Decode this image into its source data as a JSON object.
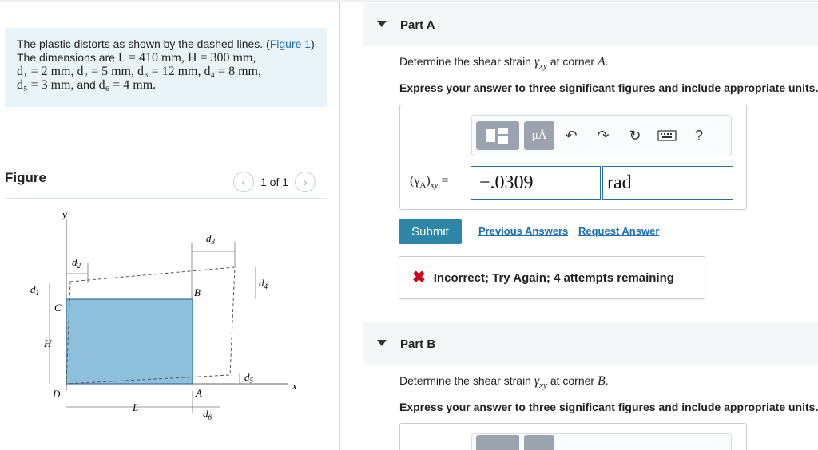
{
  "problem": {
    "intro": "The plastic distorts as shown by the dashed lines. (",
    "figure_link": "Figure 1",
    "mid": ") The dimensions are ",
    "dims_line1": "L = 410 mm, H = 300 mm,",
    "dims_line2": "d₁ = 2 mm, d₂ = 5 mm, d₃ = 12 mm, d₄ = 8 mm,",
    "dims_line3a": "d₅ = 3 mm,",
    "dims_and": " and ",
    "dims_line3b": "d₆ = 4 mm."
  },
  "figure": {
    "label": "Figure",
    "pager_text": "1 of 1",
    "prev_icon": "chevron-left-icon",
    "next_icon": "chevron-right-icon",
    "labels": {
      "y": "y",
      "x": "x",
      "A": "A",
      "B": "B",
      "C": "C",
      "D": "D",
      "H": "H",
      "L": "L",
      "d1": "d",
      "d2": "d",
      "d3": "d",
      "d4": "d",
      "d5": "d",
      "d6": "d",
      "s1": "1",
      "s2": "2",
      "s3": "3",
      "s4": "4",
      "s5": "5",
      "s6": "6"
    },
    "colors": {
      "fill": "#8ec0dc",
      "edge": "#3a6f95",
      "dash": "#555555"
    }
  },
  "partA": {
    "title": "Part A",
    "question_pre": "Determine the shear strain ",
    "gamma": "γ",
    "gamma_sub": "xy",
    "question_post": " at corner ",
    "corner": "A",
    "period": ".",
    "instruction": "Express your answer to three significant figures and include appropriate units.",
    "toolbar": {
      "template_icon": "template-icon",
      "units_label": "μÅ",
      "undo_icon": "undo-icon",
      "redo_icon": "redo-icon",
      "reset_icon": "reset-icon",
      "keyboard_icon": "keyboard-icon",
      "help_label": "?"
    },
    "answer_label_pre": "(γ",
    "answer_label_sub_a": "A",
    "answer_label_close": ")",
    "answer_label_sub_xy": "xy",
    "answer_label_eq": " =",
    "value": "−.0309",
    "unit": "rad",
    "submit_label": "Submit",
    "previous_answers": "Previous Answers",
    "request_answer": "Request Answer",
    "feedback_icon": "x-icon",
    "feedback": "Incorrect; Try Again; 4 attempts remaining"
  },
  "partB": {
    "title": "Part B",
    "question_pre": "Determine the shear strain ",
    "gamma": "γ",
    "gamma_sub": "xy",
    "question_post": " at corner ",
    "corner": "B",
    "period": ".",
    "instruction": "Express your answer to three significant figures and include appropriate units."
  }
}
